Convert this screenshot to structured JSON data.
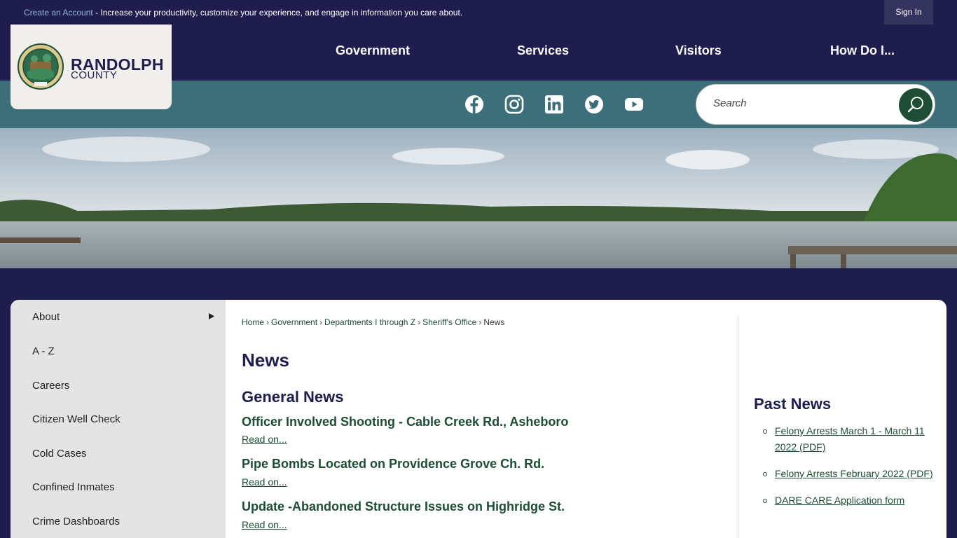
{
  "topbar": {
    "create_account_link": "Create an Account",
    "message": " - Increase your productivity, customize your experience, and engage in information you care about.",
    "signin_label": "Sign In"
  },
  "logo": {
    "line1": "RANDOLPH",
    "line2": "COUNTY"
  },
  "nav": {
    "items": [
      {
        "label": "Government"
      },
      {
        "label": "Services"
      },
      {
        "label": "Visitors"
      },
      {
        "label": "How Do I..."
      }
    ]
  },
  "social": [
    "facebook-icon",
    "instagram-icon",
    "linkedin-icon",
    "twitter-icon",
    "youtube-icon"
  ],
  "search": {
    "placeholder": "Search"
  },
  "sidebar": {
    "items": [
      {
        "label": "About"
      },
      {
        "label": "A - Z"
      },
      {
        "label": "Careers"
      },
      {
        "label": "Citizen Well Check"
      },
      {
        "label": "Cold Cases"
      },
      {
        "label": "Confined Inmates"
      },
      {
        "label": "Crime Dashboards"
      }
    ]
  },
  "breadcrumb": {
    "items": [
      "Home",
      "Government",
      "Departments I through Z",
      "Sheriff's Office"
    ],
    "current": "News"
  },
  "main": {
    "title": "News",
    "section": "General News",
    "news": [
      {
        "title": "Officer Involved Shooting - Cable Creek Rd., Asheboro",
        "link": "Read on..."
      },
      {
        "title": "Pipe Bombs Located on Providence Grove Ch. Rd.",
        "link": "Read on..."
      },
      {
        "title": "Update -Abandoned Structure Issues on Highridge St.",
        "link": "Read on..."
      }
    ]
  },
  "past_news": {
    "title": "Past News",
    "items": [
      "Felony Arrests March 1 - March 11 2022 (PDF)",
      "Felony Arrests February 2022 (PDF)",
      "DARE CARE Application form"
    ]
  },
  "colors": {
    "navy": "#1e1d4d",
    "teal_strip": "#3c6f7a",
    "green_link": "#1d4d34",
    "sidebar_bg": "#e5e4e4"
  }
}
